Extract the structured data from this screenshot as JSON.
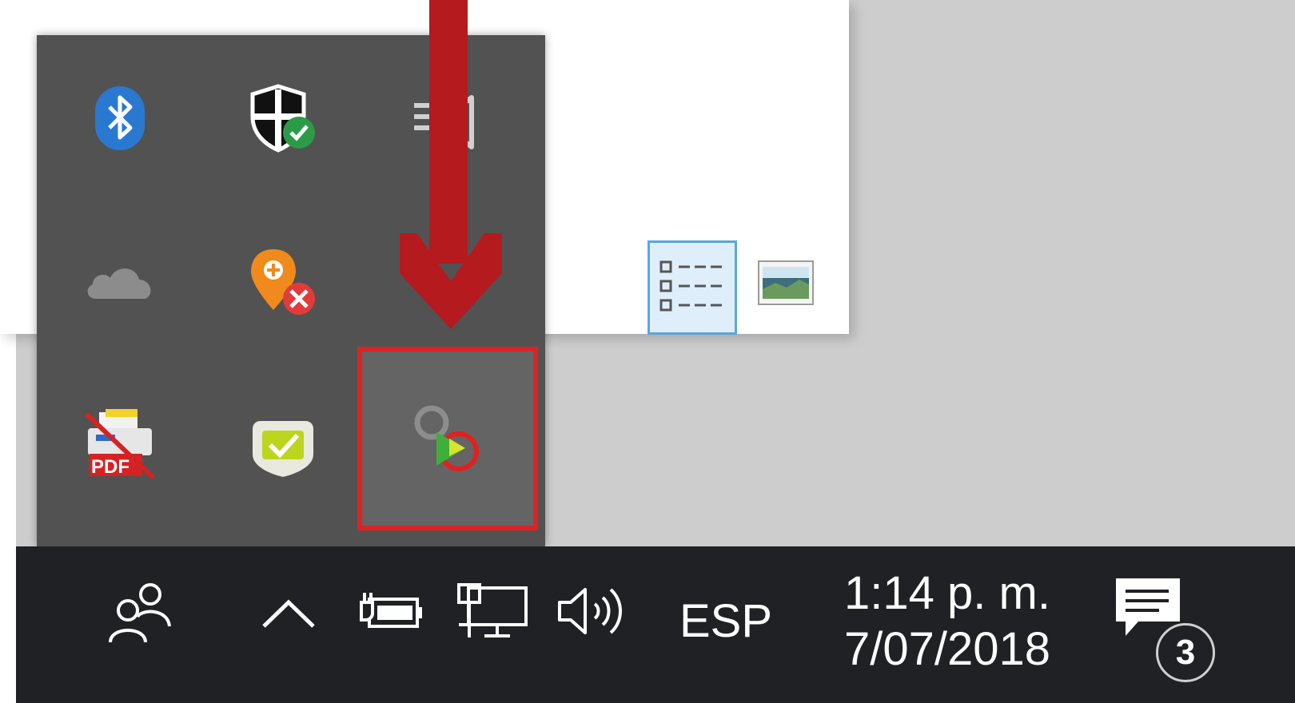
{
  "taskbar": {
    "language": "ESP",
    "clock": {
      "time": "1:14 p. m.",
      "date": "7/07/2018"
    },
    "notification_count": "3",
    "icons": [
      "people-icon",
      "chevron-up-icon",
      "battery-plug-icon",
      "network-icon",
      "volume-icon",
      "action-center-icon"
    ]
  },
  "overflow": {
    "icons": [
      "bluetooth-icon",
      "security-shield-icon",
      "speaker-icon",
      "onedrive-cloud-icon",
      "location-error-icon",
      "purple-dot-icon",
      "pdf-printer-icon",
      "checkmark-badge-icon",
      "record-play-icon"
    ],
    "pdf_label": "PDF"
  },
  "colors": {
    "taskbar_bg": "#1f2124",
    "panel_bg": "#525252",
    "highlight": "#e02121",
    "arrow": "#b51a1f",
    "bluetooth": "#2a79d1"
  }
}
